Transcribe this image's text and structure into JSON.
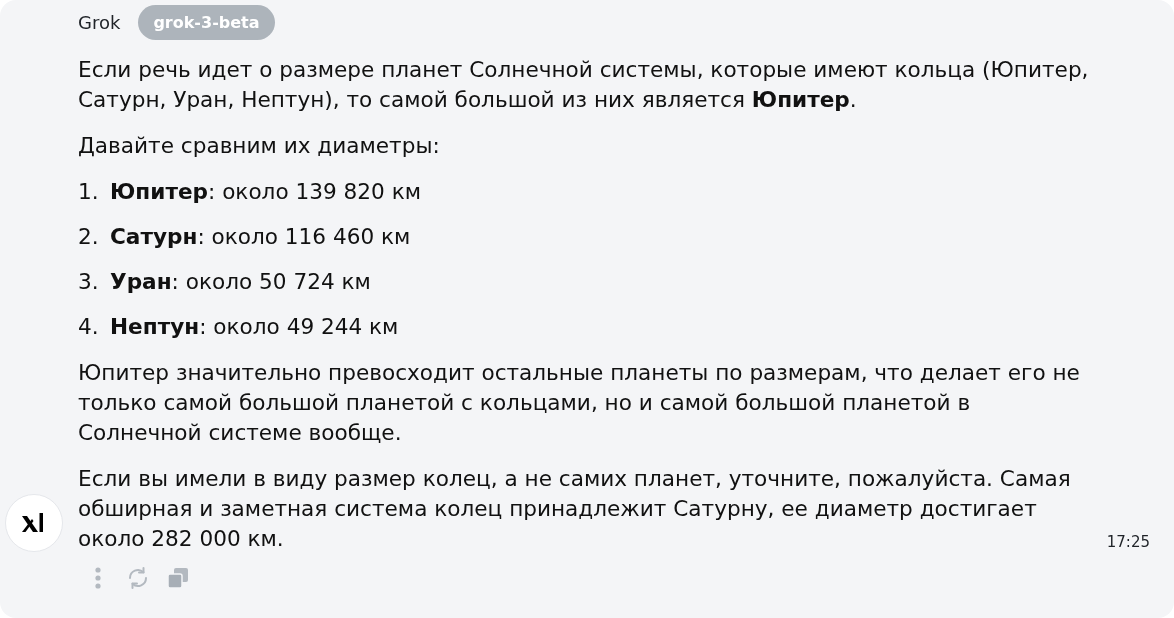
{
  "message": {
    "author": "Grok",
    "model_badge": "grok-3-beta",
    "blocks": [
      {
        "kind": "paragraph",
        "text": "Если речь идет о размере планет Солнечной системы, которые имеют кольца (Юпитер, Сатурн, Уран, Нептун), то самой большой из них является **Юпитер**."
      },
      {
        "kind": "paragraph",
        "text": "Давайте сравним их диаметры:"
      },
      {
        "kind": "list",
        "items": [
          {
            "number": "1.",
            "text": "**Юпитер**: около 139 820 км"
          },
          {
            "number": "2.",
            "text": "**Сатурн**: около 116 460 км"
          },
          {
            "number": "3.",
            "text": "**Уран**: около 50 724 км"
          },
          {
            "number": "4.",
            "text": "**Нептун**: около 49 244 км"
          }
        ]
      },
      {
        "kind": "paragraph",
        "text": "Юпитер значительно превосходит остальные планеты по размерам, что делает его не только самой большой планетой с кольцами, но и самой большой планетой в Солнечной системе вообще."
      },
      {
        "kind": "paragraph",
        "text": "Если вы имели в виду размер колец, а не самих планет, уточните, пожалуйста. Самая обширная и заметная система колец принадлежит Сатурну, ее диаметр достигает около 282 000 км."
      }
    ],
    "time": "17:25"
  }
}
